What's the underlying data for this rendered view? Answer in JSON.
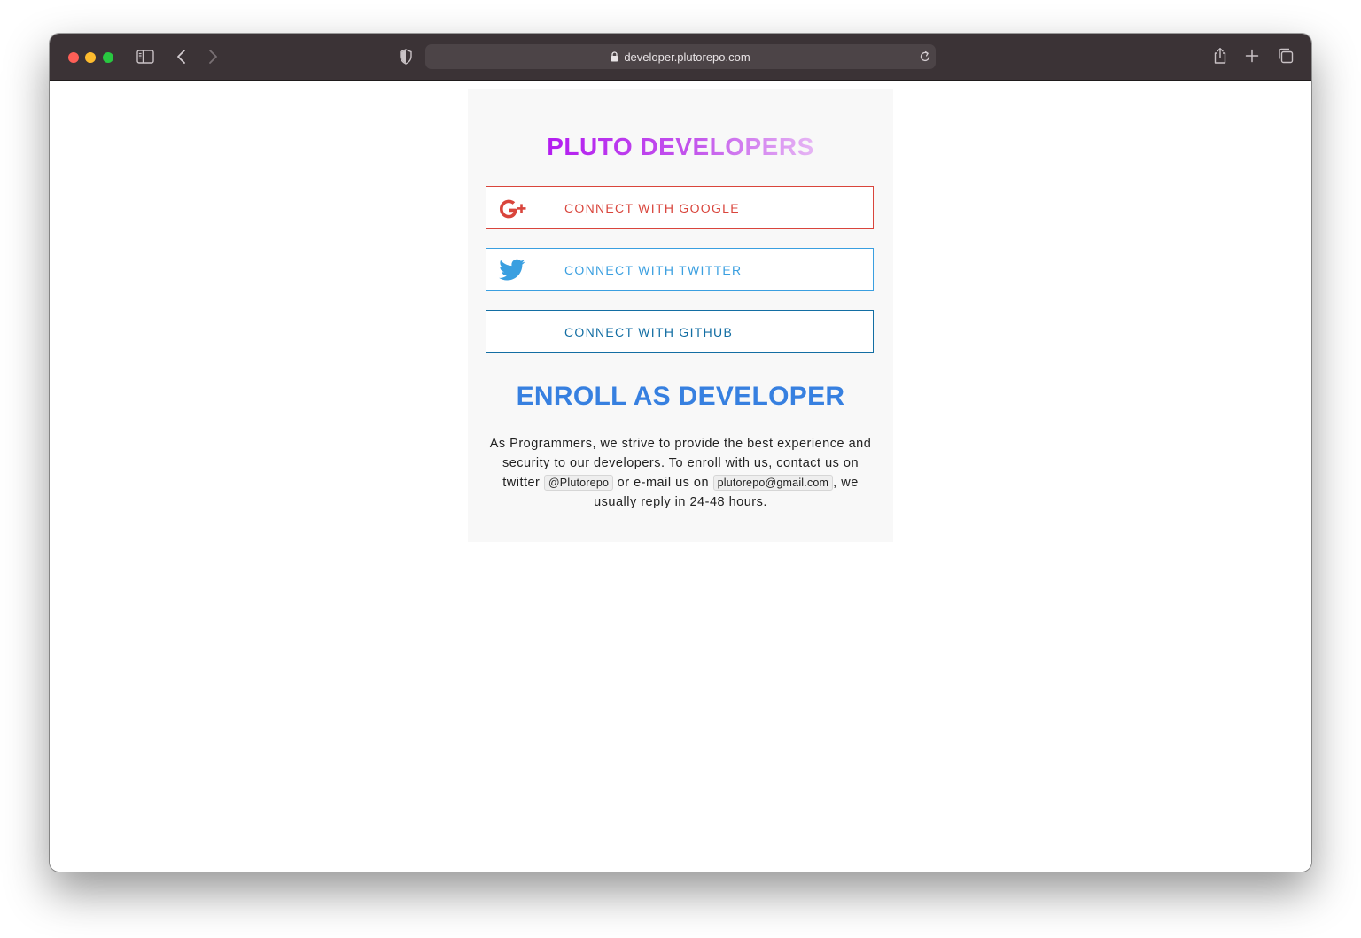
{
  "browser": {
    "url": "developer.plutorepo.com"
  },
  "page": {
    "brand": "PLUTO DEVELOPERS",
    "buttons": {
      "google": "CONNECT WITH GOOGLE",
      "twitter": "CONNECT WITH TWITTER",
      "github": "CONNECT WITH GITHUB"
    },
    "enroll": {
      "title": "ENROLL AS DEVELOPER",
      "text_1": "As Programmers, we strive to provide the best experience and security to our developers. To enroll with us, contact us on twitter",
      "twitter_handle": "@Plutorepo",
      "text_2": "or e-mail us on",
      "email": "plutorepo@gmail.com",
      "text_3": ", we usually reply in 24-48 hours."
    }
  },
  "colors": {
    "google": "#d9453c",
    "twitter": "#3a9fe0",
    "github": "#136ea3",
    "enroll_title": "#3780e0",
    "brand_gradient": [
      "#b31cf0",
      "#e6b6f4"
    ]
  },
  "icons": {
    "toolbar": [
      "sidebar-icon",
      "back-icon",
      "forward-icon",
      "shield-icon",
      "lock-icon",
      "reload-icon",
      "share-icon",
      "new-tab-icon",
      "tabs-overview-icon"
    ],
    "buttons": [
      "google-plus-icon",
      "twitter-bird-icon"
    ]
  }
}
